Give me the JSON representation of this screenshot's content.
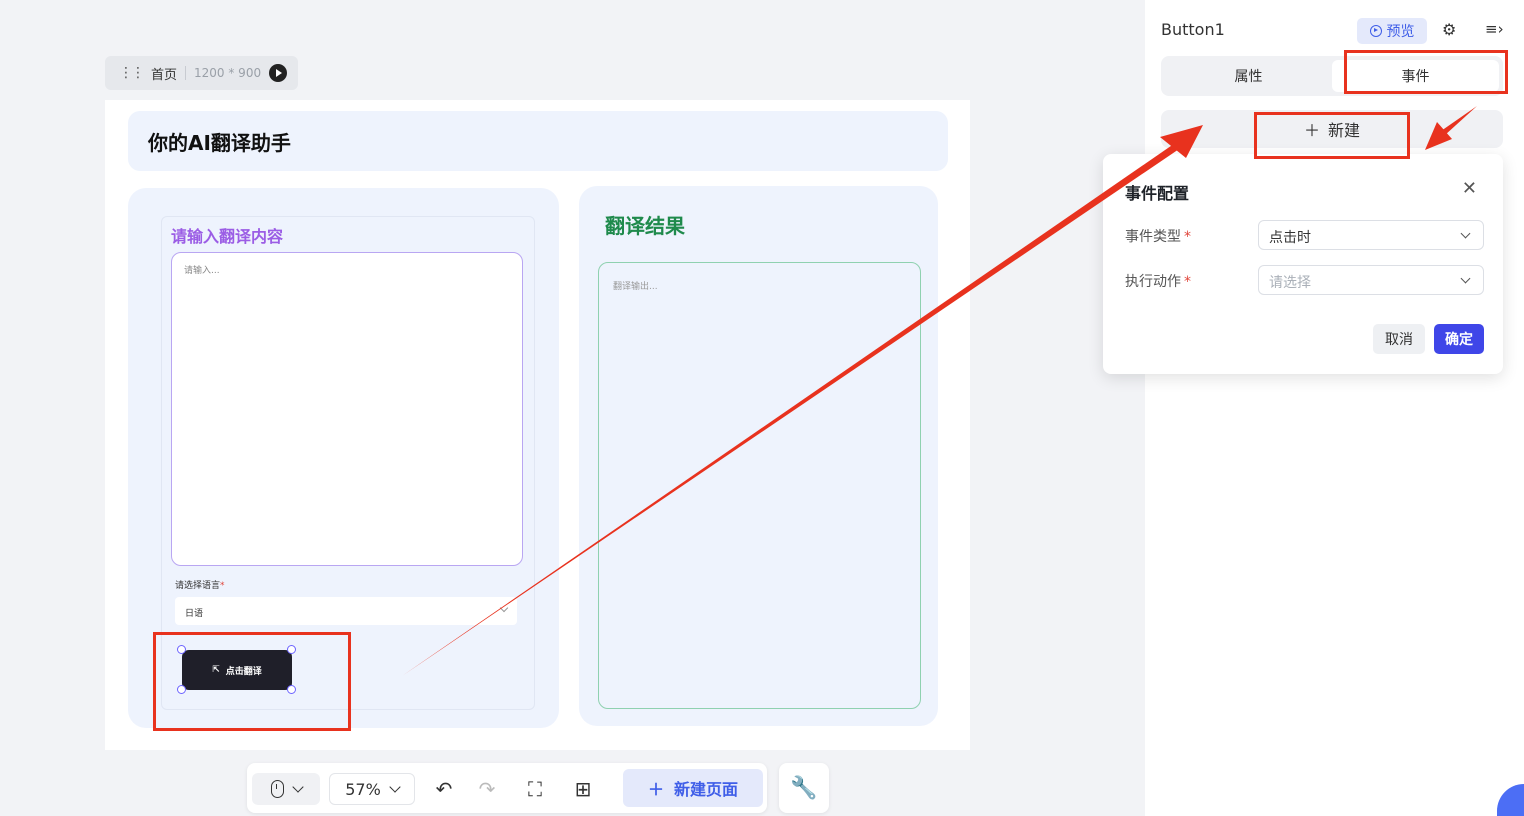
{
  "page_chip": {
    "name": "首页",
    "size": "1200 * 900"
  },
  "canvas": {
    "title": "你的AI翻译助手",
    "input_label": "请输入翻译内容",
    "input_placeholder": "请输入...",
    "language_label": "请选择语言",
    "language_value": "日语",
    "translate_button": "点击翻译",
    "result_label": "翻译结果",
    "output_placeholder": "翻译输出..."
  },
  "toolbar": {
    "zoom": "57%",
    "new_page": "新建页面"
  },
  "panel": {
    "title": "Button1",
    "preview": "预览",
    "tabs": [
      {
        "label": "属性",
        "active": false
      },
      {
        "label": "事件",
        "active": true
      }
    ],
    "new_event": "新建"
  },
  "dialog": {
    "title": "事件配置",
    "event_type_label": "事件类型",
    "event_type_value": "点击时",
    "action_label": "执行动作",
    "action_placeholder": "请选择",
    "cancel": "取消",
    "confirm": "确定"
  },
  "colors": {
    "accent": "#3f46e8",
    "annotation": "#e8321e",
    "input_label": "#9b5de5",
    "result_label": "#1f8a4c"
  }
}
